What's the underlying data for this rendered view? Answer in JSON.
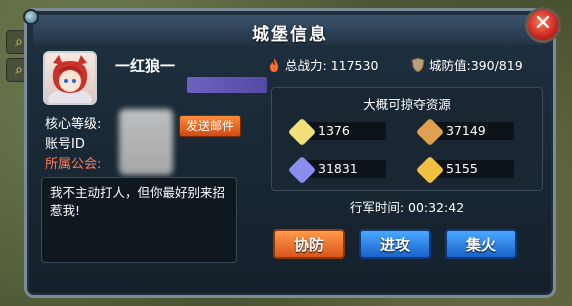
{
  "header": {
    "title": "城堡信息"
  },
  "player": {
    "name": "一红狼一",
    "level_label": "核心等级:",
    "account_label": "账号ID",
    "guild_label": "所属公会:",
    "send_mail_label": "发送邮件",
    "message": "我不主动打人，但你最好别来招惹我!"
  },
  "stats": {
    "power_label": "总战力:",
    "power_value": "117530",
    "defense_label": "城防值:",
    "defense_value": "390/819"
  },
  "resources": {
    "title": "大概可掠夺资源",
    "items": [
      {
        "value": "1376",
        "color": "#f2e07a"
      },
      {
        "value": "37149",
        "color": "#e0a050"
      },
      {
        "value": "31831",
        "color": "#8a8cf0"
      },
      {
        "value": "5155",
        "color": "#f2c040"
      }
    ]
  },
  "march": {
    "label": "行军时间:",
    "value": "00:32:42"
  },
  "actions": {
    "assist_label": "协防",
    "attack_label": "进攻",
    "rally_label": "集火"
  },
  "colors": {
    "accent": "#d9561a",
    "guild_label": "#ff7a5a",
    "button_blue": "#1a62c9"
  },
  "icons": [
    "search-icon",
    "map-icon",
    "close-icon",
    "flame-icon",
    "shield-icon",
    "gold-ore-icon",
    "wood-icon",
    "crystal-icon",
    "gold-icon"
  ]
}
